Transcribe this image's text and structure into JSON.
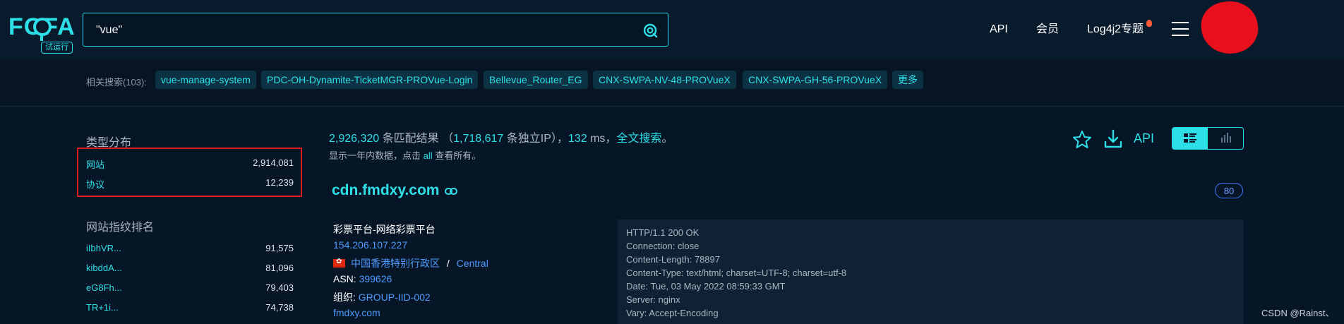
{
  "logo": {
    "text": "FOFA",
    "badge": "试运行"
  },
  "search": {
    "query": "\"vue\"",
    "placeholder": ""
  },
  "nav": {
    "api": "API",
    "member": "会员",
    "log4j": "Log4j2专题"
  },
  "related": {
    "label": "相关搜索(103):",
    "tags": [
      "vue-manage-system",
      "PDC-OH-Dynamite-TicketMGR-PROVue-Login",
      "Bellevue_Router_EG",
      "CNX-SWPA-NV-48-PROVueX",
      "CNX-SWPA-GH-56-PROVueX",
      "更多"
    ]
  },
  "sidebar": {
    "type_title": "类型分布",
    "types": [
      {
        "label": "网站",
        "count": "2,914,081"
      },
      {
        "label": "协议",
        "count": "12,239"
      }
    ],
    "rank_title": "网站指纹排名",
    "ranks": [
      {
        "label": "iIbhVR...",
        "count": "91,575"
      },
      {
        "label": "kibddA...",
        "count": "81,096"
      },
      {
        "label": "eG8Fh...",
        "count": "79,403"
      },
      {
        "label": "TR+1i...",
        "count": "74,738"
      }
    ]
  },
  "summary": {
    "matches": "2,926,320",
    "matches_label": "条匹配结果",
    "open_paren": "（",
    "ips": "1,718,617",
    "ips_label": "条独立IP）",
    "comma": "，",
    "time": "132",
    "time_unit": "ms，",
    "fulltext": "全文搜索",
    "end": "。",
    "note_pre": "显示一年内数据，点击",
    "note_link": "all",
    "note_post": "查看所有。"
  },
  "tools": {
    "api": "API"
  },
  "result": {
    "host": "cdn.fmdxy.com",
    "port": "80",
    "title": "彩票平台-网络彩票平台",
    "ip": "154.206.107.227",
    "region": "中国香港特别行政区",
    "separator": "/",
    "city": "Central",
    "asn_label": "ASN:",
    "asn": "399626",
    "org_label": "组织:",
    "org": "GROUP-IID-002",
    "domain": "fmdxy.com",
    "headers": [
      "HTTP/1.1 200 OK",
      "Connection: close",
      "Content-Length: 78897",
      "Content-Type: text/html; charset=UTF-8; charset=utf-8",
      "Date: Tue, 03 May 2022 08:59:33 GMT",
      "Server: nginx",
      "Vary: Accept-Encoding"
    ]
  },
  "watermark": "CSDN @Rainst、",
  "colors": {
    "accent": "#2de0e8",
    "background": "#071626",
    "link": "#4f9bff",
    "highlight_box": "#e01c22"
  }
}
